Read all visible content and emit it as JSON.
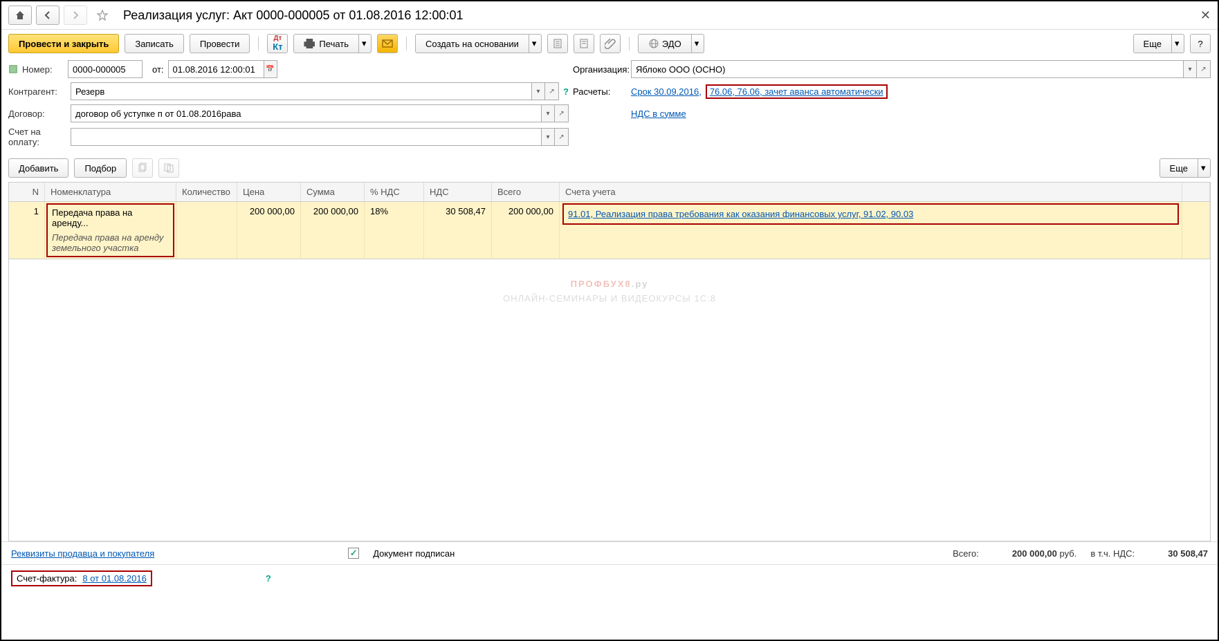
{
  "title": "Реализация услуг: Акт 0000-000005 от 01.08.2016 12:00:01",
  "toolbar": {
    "post_close": "Провести и закрыть",
    "save": "Записать",
    "post": "Провести",
    "print": "Печать",
    "create_based": "Создать на основании",
    "edo": "ЭДО",
    "more": "Еще",
    "help": "?"
  },
  "form": {
    "number_lbl": "Номер:",
    "number": "0000-000005",
    "ot": "от:",
    "date": "01.08.2016 12:00:01",
    "org_lbl": "Организация:",
    "org": "Яблоко ООО (ОСНО)",
    "contr_lbl": "Контрагент:",
    "contr": "Резерв",
    "calc_lbl": "Расчеты:",
    "calc_link1": "Срок 30.09.2016,",
    "calc_link2": "76.06, 76.06, зачет аванса автоматически",
    "dog_lbl": "Договор:",
    "dog": "договор об уступке п от 01.08.2016рава",
    "vat_link": "НДС в сумме",
    "invoice_lbl": "Счет на оплату:"
  },
  "tabletools": {
    "add": "Добавить",
    "pick": "Подбор",
    "more": "Еще"
  },
  "grid": {
    "headers": {
      "n": "N",
      "nom": "Номенклатура",
      "qty": "Количество",
      "price": "Цена",
      "sum": "Сумма",
      "vat_pct": "% НДС",
      "nds": "НДС",
      "total": "Всего",
      "acc": "Счета учета"
    },
    "row": {
      "n": "1",
      "nom": "Передача права на аренду...",
      "nom_sub": "Передача права на аренду земельного участка",
      "price": "200 000,00",
      "sum": "200 000,00",
      "vat_pct": "18%",
      "nds": "30 508,47",
      "total": "200 000,00",
      "acc": "91.01, Реализация права требования как оказания финансовых услуг, 91.02, 90.03"
    }
  },
  "watermark": {
    "line1a": "ПРОФБУХ8",
    "line1b": ".ру",
    "line2": "ОНЛАЙН-СЕМИНАРЫ И ВИДЕОКУРСЫ 1С:8"
  },
  "footer": {
    "req_link": "Реквизиты продавца и покупателя",
    "doc_signed": "Документ подписан",
    "total_lbl": "Всего:",
    "total_val": "200 000,00",
    "rub": "руб.",
    "incl_nds": "в т.ч. НДС:",
    "nds_val": "30 508,47",
    "sf_lbl": "Счет-фактура:",
    "sf_link": "8 от 01.08.2016",
    "sf_help": "?"
  }
}
